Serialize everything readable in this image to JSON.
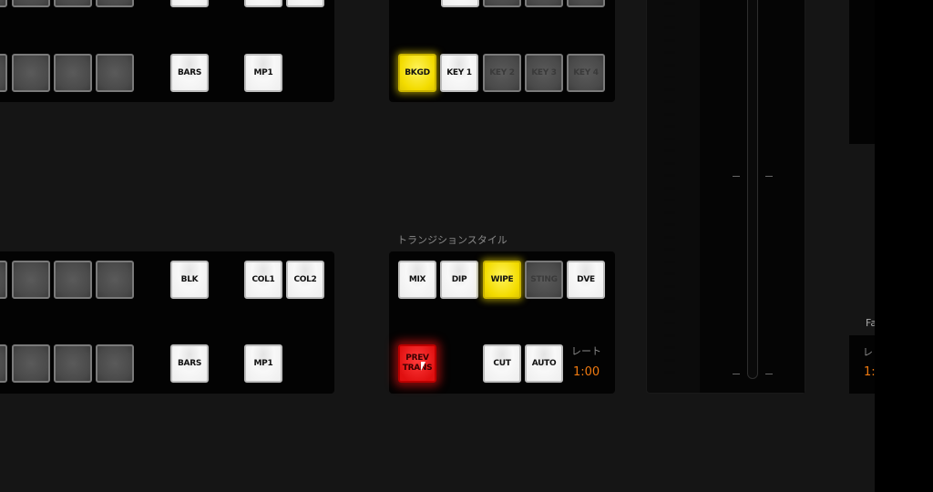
{
  "program_row_top": {
    "buttons": [
      "",
      "",
      "",
      "",
      "BARS",
      "MP1"
    ]
  },
  "program_row_bottom": {
    "buttons": [
      "",
      "",
      "",
      "",
      "BLK",
      "COL1",
      "COL2"
    ]
  },
  "preview_row_bottom": {
    "buttons": [
      "",
      "",
      "",
      "",
      "BARS",
      "MP1"
    ]
  },
  "next_transition": {
    "buttons": [
      "BKGD",
      "KEY 1",
      "KEY 2",
      "KEY 3",
      "KEY 4"
    ]
  },
  "transition_style": {
    "title": "トランジションスタイル",
    "buttons": [
      "MIX",
      "DIP",
      "WIPE",
      "STING",
      "DVE"
    ],
    "prev_trans": "PREV TRANS",
    "cut": "CUT",
    "auto": "AUTO",
    "rate_label": "レート",
    "rate_value": "1:00"
  },
  "side_panel": {
    "title_partial": "Fa",
    "rate_label_partial": "レ",
    "rate_value_partial": "1:"
  },
  "colors": {
    "active_yellow": "#f3dc00",
    "active_red": "#e01010",
    "rate_orange": "#f07a10"
  }
}
